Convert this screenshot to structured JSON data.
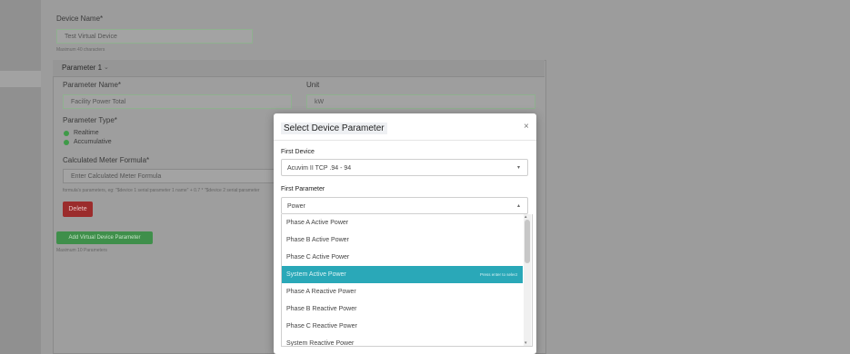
{
  "form": {
    "device_name_label": "Device Name*",
    "device_name_value": "Test Virtual Device",
    "device_name_hint": "Maximum 40 characters",
    "parameter_header": "Parameter 1",
    "parameter_name_label": "Parameter Name*",
    "parameter_name_value": "Facility Power Total",
    "unit_label": "Unit",
    "unit_value": "kW",
    "parameter_type_label": "Parameter Type*",
    "type_options": [
      "Realtime",
      "Accumulative"
    ],
    "formula_label": "Calculated Meter Formula*",
    "formula_placeholder": "Enter Calculated Meter Formula",
    "formula_hint": "formula's parameters, eg: \"$device 1 serial:parameter 1 name\" + 0.7 * \"$device 2 serial:parameter",
    "delete_button": "Delete",
    "add_button": "Add Virtual Device Parameter",
    "add_hint": "Maximum 10 Parameters"
  },
  "modal": {
    "title": "Select Device Parameter",
    "close": "×",
    "first_device_label": "First Device",
    "first_device_value": "Acuvim II TCP .94 - 94",
    "first_parameter_label": "First Parameter",
    "first_parameter_value": "Power",
    "options": [
      "Phase A Active Power",
      "Phase B Active Power",
      "Phase C Active Power",
      "System Active Power",
      "Phase A Reactive Power",
      "Phase B Reactive Power",
      "Phase C Reactive Power",
      "System Reactive Power"
    ],
    "selected_hint": "Press enter to select"
  },
  "colors": {
    "accent_green": "#3f9a48",
    "danger": "#9b2c2c",
    "selected_option": "#2aa8b8"
  }
}
